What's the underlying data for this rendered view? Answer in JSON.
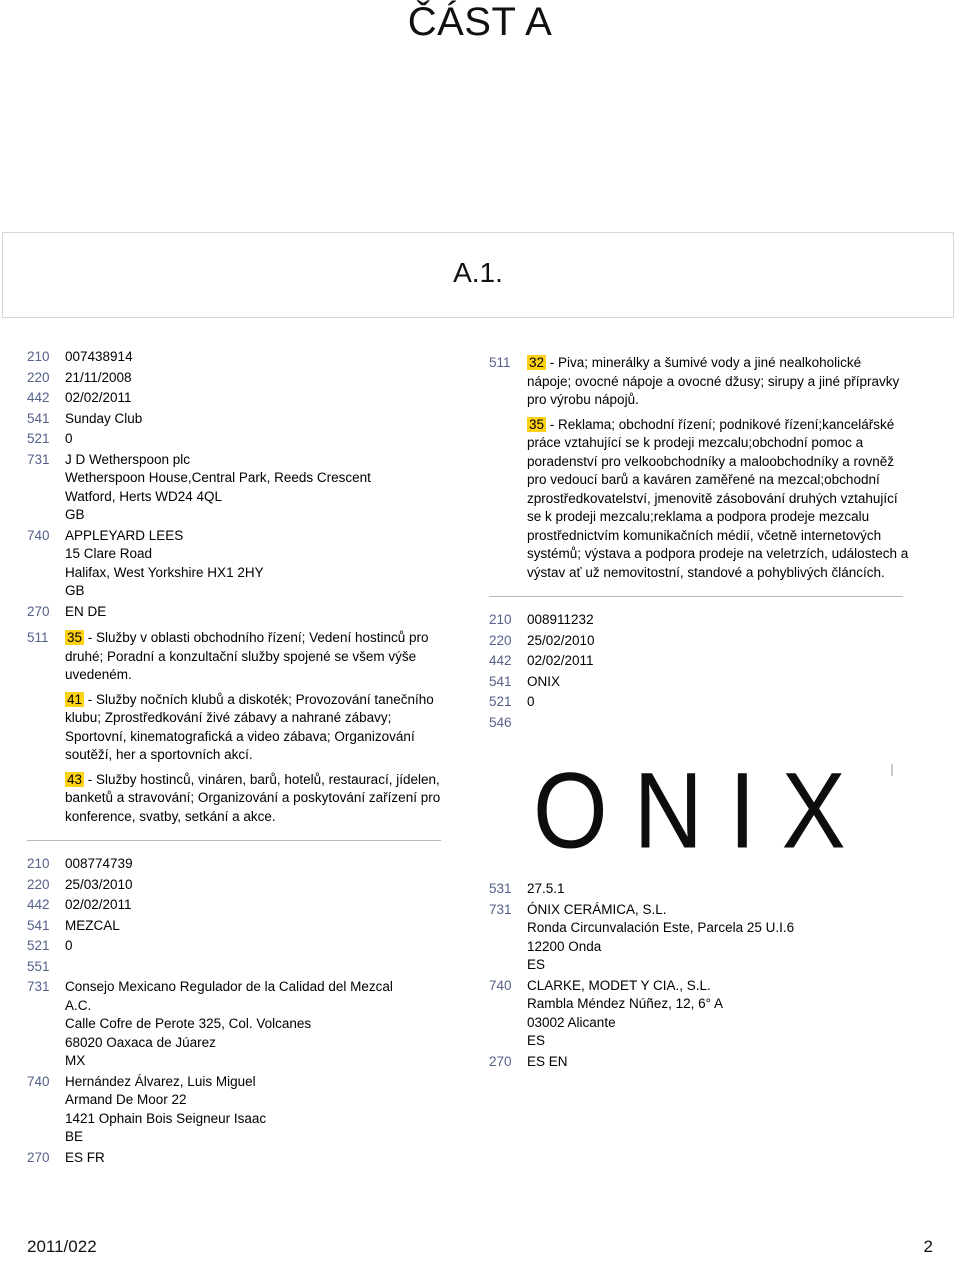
{
  "page": {
    "part_title": "ČÁST A",
    "section_label": "A.1."
  },
  "footer": {
    "issue": "2011/022",
    "page_number": "2"
  },
  "left_column": {
    "records": [
      {
        "fields": [
          {
            "code": "210",
            "lines": [
              "007438914"
            ]
          },
          {
            "code": "220",
            "lines": [
              "21/11/2008"
            ]
          },
          {
            "code": "442",
            "lines": [
              "02/02/2011"
            ]
          },
          {
            "code": "541",
            "lines": [
              "Sunday Club"
            ]
          },
          {
            "code": "521",
            "lines": [
              "0"
            ]
          },
          {
            "code": "731",
            "lines": [
              "J D Wetherspoon plc",
              "Wetherspoon House,Central Park, Reeds Crescent",
              "Watford, Herts WD24 4QL",
              "GB"
            ]
          },
          {
            "code": "740",
            "lines": [
              "APPLEYARD LEES",
              "15 Clare Road",
              "Halifax, West Yorkshire HX1 2HY",
              "GB"
            ]
          },
          {
            "code": "270",
            "lines": [
              "EN DE"
            ]
          }
        ],
        "classes_code": "511",
        "classes": [
          {
            "number": "35",
            "text": " - Služby v oblasti obchodního řízení; Vedení hostinců pro druhé; Poradní a konzultační služby spojené se všem výše uvedeném."
          },
          {
            "number": "41",
            "text": " - Služby nočních klubů a diskoték; Provozování tanečního klubu; Zprostředkování živé zábavy a nahrané zábavy; Sportovní, kinematografická a video zábava; Organizování soutěží, her a sportovních akcí."
          },
          {
            "number": "43",
            "text": " - Služby hostinců, vináren, barů, hotelů, restaurací, jídelen, banketů a stravování; Organizování a poskytování zařízení pro konference, svatby, setkání a akce."
          }
        ]
      },
      {
        "fields": [
          {
            "code": "210",
            "lines": [
              "008774739"
            ]
          },
          {
            "code": "220",
            "lines": [
              "25/03/2010"
            ]
          },
          {
            "code": "442",
            "lines": [
              "02/02/2011"
            ]
          },
          {
            "code": "541",
            "lines": [
              "MEZCAL"
            ]
          },
          {
            "code": "521",
            "lines": [
              "0"
            ]
          },
          {
            "code": "551",
            "lines": [
              ""
            ]
          },
          {
            "code": "731",
            "lines": [
              "Consejo Mexicano Regulador de la Calidad del Mezcal",
              "A.C.",
              "Calle Cofre de Perote 325, Col. Volcanes",
              "68020 Oaxaca de Júarez",
              "MX"
            ]
          },
          {
            "code": "740",
            "lines": [
              "Hernández Álvarez, Luis Miguel",
              "Armand De Moor 22",
              "1421 Ophain Bois Seigneur Isaac",
              "BE"
            ]
          },
          {
            "code": "270",
            "lines": [
              "ES FR"
            ]
          }
        ]
      }
    ]
  },
  "right_column": {
    "records": [
      {
        "classes_code": "511",
        "classes": [
          {
            "number": "32",
            "text": " - Piva; minerálky a šumivé vody a jiné nealkoholické nápoje; ovocné nápoje a ovocné džusy; sirupy a jiné přípravky pro výrobu nápojů."
          },
          {
            "number": "35",
            "text": " - Reklama; obchodní řízení; podnikové řízení;kancelářské práce vztahující se k prodeji mezcalu;obchodní pomoc a poradenství pro velkoobchodníky a maloobchodníky a rovněž pro vedoucí barů a kaváren zaměřené na mezcal;obchodní zprostředkovatelství, jmenovitě zásobování druhých vztahující se k prodeji mezcalu;reklama a podpora prodeje mezcalu prostřednictvím komunikačních médií, včetně internetových systémů; výstava a podpora prodeje na veletrzích, událostech a výstav ať už nemovitostní, standové a pohyblivých článcích."
          }
        ]
      },
      {
        "fields": [
          {
            "code": "210",
            "lines": [
              "008911232"
            ]
          },
          {
            "code": "220",
            "lines": [
              "25/02/2010"
            ]
          },
          {
            "code": "442",
            "lines": [
              "02/02/2011"
            ]
          },
          {
            "code": "541",
            "lines": [
              "ONIX"
            ]
          },
          {
            "code": "521",
            "lines": [
              "0"
            ]
          },
          {
            "code": "546",
            "lines": [
              ""
            ]
          }
        ],
        "mark_image": {
          "wordmark": "ONIX"
        },
        "fields_after": [
          {
            "code": "531",
            "lines": [
              "27.5.1"
            ]
          },
          {
            "code": "731",
            "lines": [
              "ÓNIX CERÁMICA, S.L.",
              "Ronda Circunvalación Este, Parcela 25 U.I.6",
              "12200 Onda",
              "ES"
            ]
          },
          {
            "code": "740",
            "lines": [
              "CLARKE, MODET Y CIA., S.L.",
              "Rambla Méndez Núñez, 12, 6° A",
              "03002 Alicante",
              "ES"
            ]
          },
          {
            "code": "270",
            "lines": [
              "ES EN"
            ]
          }
        ]
      }
    ]
  },
  "colors": {
    "field_code": "#55618a",
    "class_highlight": "#fcd116",
    "rule": "#b9b9b9",
    "section_border": "#d6d6d6"
  }
}
